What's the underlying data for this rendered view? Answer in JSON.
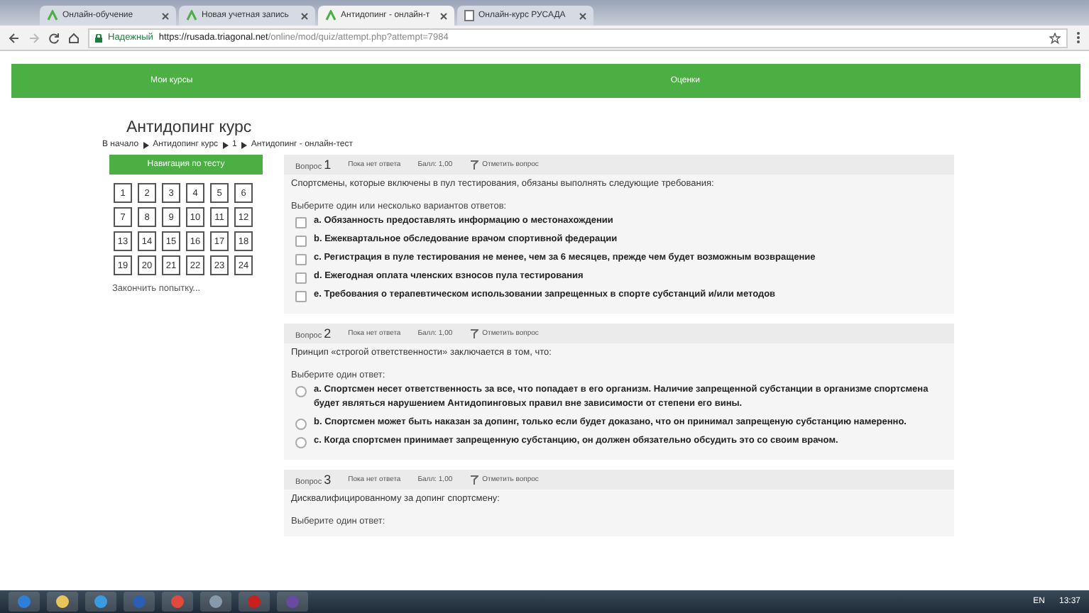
{
  "browser": {
    "tabs": [
      {
        "label": "Онлайн-обучение",
        "selected": false
      },
      {
        "label": "Новая учетная запись",
        "selected": false
      },
      {
        "label": "Антидопинг - онлайн-т",
        "selected": true
      },
      {
        "label": "Онлайн-курс РУСАДА",
        "selected": false
      }
    ],
    "secure_label": "Надежный",
    "url_host": "https://rusada.triagonal.net",
    "url_path": "/online/mod/quiz/attempt.php?attempt=7984"
  },
  "nav": {
    "left": "Мои курсы",
    "right": "Оценки"
  },
  "page": {
    "title": "Антидопинг курс",
    "breadcrumb": [
      "В начало",
      "Антидопинг курс",
      "1",
      "Антидопинг - онлайн-тест"
    ]
  },
  "quiz_nav": {
    "title": "Навигация по тесту",
    "numbers": [
      "1",
      "2",
      "3",
      "4",
      "5",
      "6",
      "7",
      "8",
      "9",
      "10",
      "11",
      "12",
      "13",
      "14",
      "15",
      "16",
      "17",
      "18",
      "19",
      "20",
      "21",
      "22",
      "23",
      "24"
    ],
    "finish": "Закончить попытку..."
  },
  "questions": [
    {
      "label": "Вопрос",
      "number": "1",
      "status": "Пока нет ответа",
      "points": "Балл: 1,00",
      "flag": "Отметить вопрос",
      "text": "Спортсмены, которые включены в пул тестирования, обязаны выполнять следующие требования:",
      "prompt": "Выберите один или несколько вариантов ответов:",
      "kind": "checkbox",
      "answers": [
        {
          "text": "a. Обязанность предоставлять информацию о местонахождении",
          "checked": false
        },
        {
          "text": "b. Ежеквартальное обследование врачом спортивной федерации",
          "checked": false
        },
        {
          "text": "c. Регистрация в пуле тестирования не менее, чем за 6 месяцев, прежде чем будет возможным возвращение",
          "checked": false
        },
        {
          "text": "d. Ежегодная оплата членских взносов пула тестирования",
          "checked": false
        },
        {
          "text": "e. Требования о терапевтическом использовании запрещенных в спорте субстанций и/или методов",
          "checked": false
        }
      ]
    },
    {
      "label": "Вопрос",
      "number": "2",
      "status": "Пока нет ответа",
      "points": "Балл: 1,00",
      "flag": "Отметить вопрос",
      "text": "Принцип «строгой ответственности» заключается в том, что:",
      "prompt": "Выберите один ответ:",
      "kind": "radio",
      "answers": [
        {
          "text": "a. Спортсмен несет ответственность за все, что попадает в его организм. Наличие запрещенной субстанции в организме спортсмена будет являться нарушением Антидопинговых правил вне зависимости от степени его вины.",
          "checked": false
        },
        {
          "text": "b. Спортсмен может быть наказан за допинг, только если будет доказано, что он принимал запрещеную субстанцию намеренно.",
          "checked": false
        },
        {
          "text": "c. Когда спортсмен принимает запрещенную субстанцию, он должен обязательно обсудить это со своим врачом.",
          "checked": false
        }
      ]
    },
    {
      "label": "Вопрос",
      "number": "3",
      "status": "Пока нет ответа",
      "points": "Балл: 1,00",
      "flag": "Отметить вопрос",
      "text": "Дисквалифицированному за допинг спортсмену:",
      "prompt": "Выберите один ответ:",
      "kind": "radio"
    }
  ],
  "taskbar": {
    "language": "EN",
    "time": "13:37"
  }
}
